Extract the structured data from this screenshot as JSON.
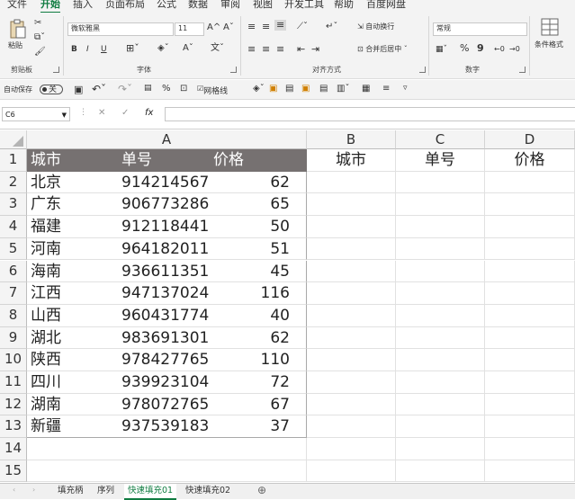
{
  "ribbon_tabs": [
    "文件",
    "开始",
    "插入",
    "页面布局",
    "公式",
    "数据",
    "审阅",
    "视图",
    "开发工具",
    "帮助",
    "百度网盘"
  ],
  "ribbon": {
    "clipboard": {
      "paste": "粘贴",
      "label": "剪贴板"
    },
    "font": {
      "name": "微软雅黑",
      "size": "11",
      "bold": "B",
      "italic": "I",
      "underline": "U",
      "grow": "A^",
      "shrink": "Aˇ",
      "label": "字体"
    },
    "alignment": {
      "wrap": "自动换行",
      "merge": "合并后居中",
      "label": "对齐方式"
    },
    "number": {
      "format": "常规",
      "percent": "%",
      "comma": "9",
      "label": "数字"
    },
    "styles": {
      "conditional": "条件格式"
    }
  },
  "quick_access": {
    "autosave": "自动保存",
    "toggle": "关",
    "gridlines": "网格线"
  },
  "formula_bar": {
    "name_box": "C6",
    "cancel": "✕",
    "enter": "✓",
    "fx": "fx",
    "value": ""
  },
  "columns": [
    "A",
    "B",
    "C",
    "D"
  ],
  "rows": [
    "1",
    "2",
    "3",
    "4",
    "5",
    "6",
    "7",
    "8",
    "9",
    "10",
    "11",
    "12",
    "13",
    "14",
    "15"
  ],
  "table": {
    "headers": [
      "城市",
      "单号",
      "价格"
    ],
    "rows": [
      [
        "北京",
        "914214567",
        "62"
      ],
      [
        "广东",
        "906773286",
        "65"
      ],
      [
        "福建",
        "912118441",
        "50"
      ],
      [
        "河南",
        "964182011",
        "51"
      ],
      [
        "海南",
        "936611351",
        "45"
      ],
      [
        "江西",
        "947137024",
        "116"
      ],
      [
        "山西",
        "960431774",
        "40"
      ],
      [
        "湖北",
        "983691301",
        "62"
      ],
      [
        "陕西",
        "978427765",
        "110"
      ],
      [
        "四川",
        "939923104",
        "72"
      ],
      [
        "湖南",
        "978072765",
        "67"
      ],
      [
        "新疆",
        "937539183",
        "37"
      ]
    ]
  },
  "right_headers": [
    "城市",
    "单号",
    "价格"
  ],
  "sheet_tabs": [
    "填充柄",
    "序列",
    "快速填充01",
    "快速填充02"
  ],
  "active_sheet": "快速填充01",
  "add_sheet": "⊕",
  "colors": {
    "accent": "#107c41",
    "header_fill": "#767171"
  }
}
